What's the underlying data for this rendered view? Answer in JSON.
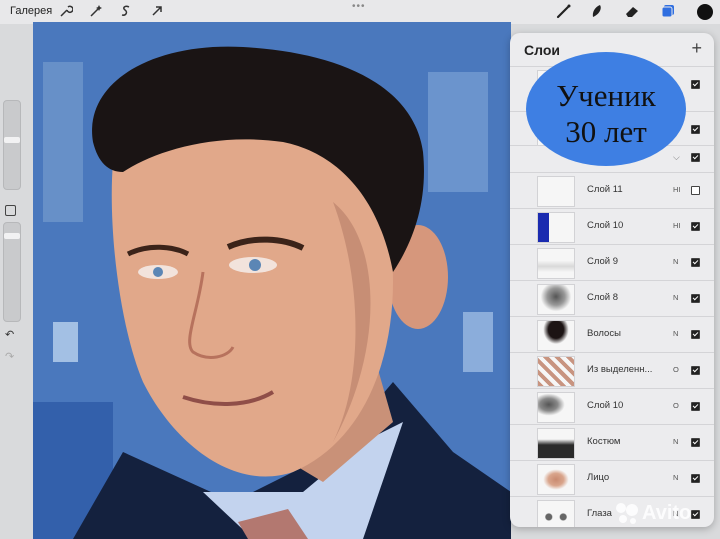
{
  "toolbar": {
    "gallery_label": "Галерея",
    "tools_left": [
      "wrench-icon",
      "magic-wand-icon",
      "selection-icon",
      "transform-arrow-icon"
    ],
    "tools_right": [
      "brush-icon",
      "smudge-icon",
      "eraser-icon",
      "layers-icon",
      "color-swatch-icon"
    ],
    "active_color": "#111111",
    "accent": "#2f6ee0"
  },
  "sidebar": {
    "undo_icon": "undo-icon",
    "redo_icon": "redo-icon"
  },
  "layers": {
    "title": "Слои",
    "add_icon": "plus-icon",
    "items": [
      {
        "name": "Слой 11",
        "mode": "HI",
        "visible": false
      },
      {
        "name": "Слой 10",
        "mode": "HI",
        "visible": true
      },
      {
        "name": "Слой 9",
        "mode": "N",
        "visible": true
      },
      {
        "name": "Слой 8",
        "mode": "N",
        "visible": true
      },
      {
        "name": "Волосы",
        "mode": "N",
        "visible": true
      },
      {
        "name": "Из выделенн...",
        "mode": "O",
        "visible": true
      },
      {
        "name": "Слой 10",
        "mode": "O",
        "visible": true
      },
      {
        "name": "Костюм",
        "mode": "N",
        "visible": true
      },
      {
        "name": "Лицо",
        "mode": "N",
        "visible": true
      },
      {
        "name": "Глаза",
        "mode": "N",
        "visible": true
      }
    ]
  },
  "promo": {
    "line1": "Ученик",
    "line2": "30 лет",
    "color": "#3e7fe3"
  },
  "watermark": {
    "text": "Avito"
  }
}
